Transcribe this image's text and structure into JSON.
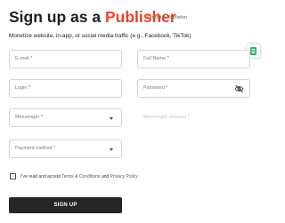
{
  "header": {
    "title_prefix": "Sign up as a",
    "title_brand": "Publisher",
    "alt_link": "I'm not a Publisher",
    "subtitle": "Monetize website, in-app, or social media traffic (e.g., Facebook, TikTok)"
  },
  "form": {
    "email": {
      "placeholder": "E-mail *"
    },
    "full_name": {
      "placeholder": "Full Name *"
    },
    "login": {
      "placeholder": "Login *"
    },
    "password": {
      "placeholder": "Password *",
      "icon": "eye-off-icon"
    },
    "messenger": {
      "placeholder": "Messenger *",
      "icon": "chevron-down-icon"
    },
    "messenger_account": {
      "placeholder": "Messenger account *"
    },
    "payment_method": {
      "placeholder": "Payment method *",
      "icon": "chevron-down-icon"
    }
  },
  "agreement": {
    "prefix": "I've read and accept",
    "terms_link": "Terms & Conditions",
    "and": "and",
    "privacy_link": "Privacy Policy"
  },
  "submit_label": "SIGN UP",
  "colors": {
    "brand": "#e8442a",
    "button_bg": "#262626",
    "extension_icon": "#2fb35a"
  }
}
